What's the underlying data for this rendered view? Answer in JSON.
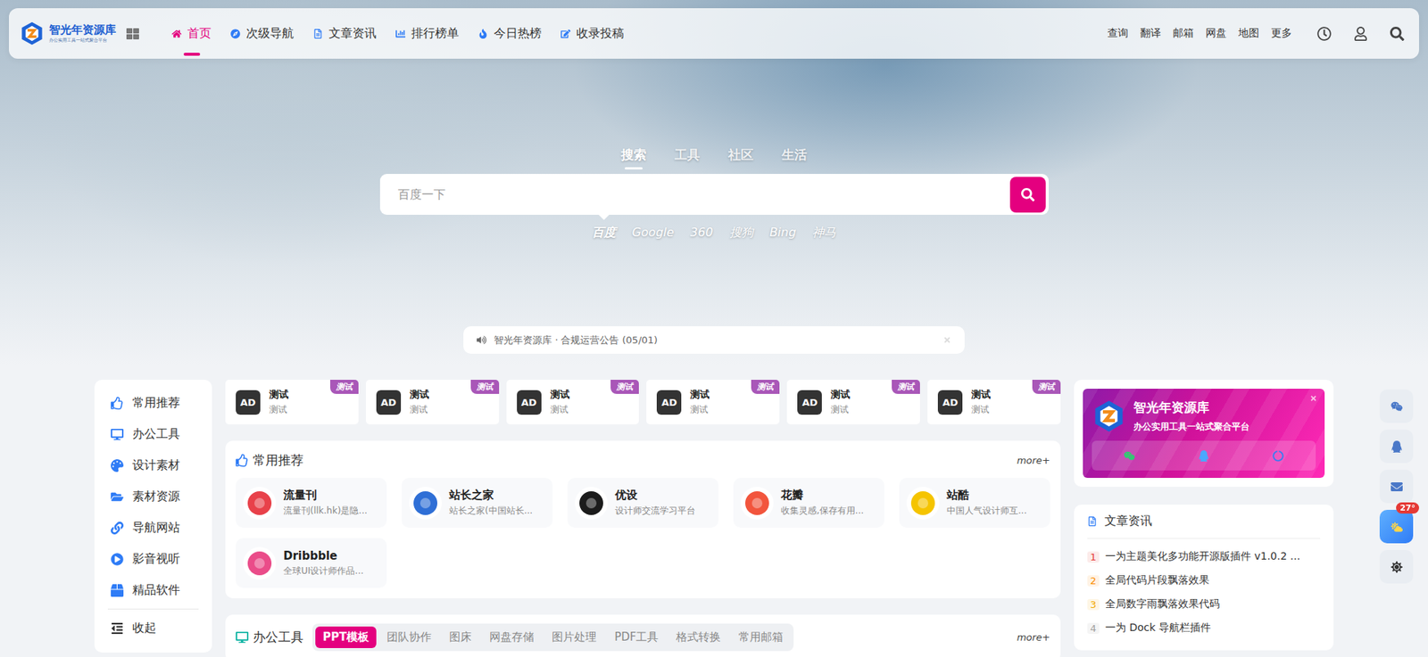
{
  "header": {
    "logo": {
      "title": "智光年资源库",
      "subtitle": "办公实用工具一站式聚合平台"
    },
    "nav": [
      {
        "label": "首页",
        "selected": true
      },
      {
        "label": "次级导航",
        "selected": false
      },
      {
        "label": "文章资讯",
        "selected": false
      },
      {
        "label": "排行榜单",
        "selected": false
      },
      {
        "label": "今日热榜",
        "selected": false
      },
      {
        "label": "收录投稿",
        "selected": false
      }
    ],
    "links": [
      "查询",
      "翻译",
      "邮箱",
      "网盘",
      "地图",
      "更多"
    ]
  },
  "search": {
    "tabs": [
      {
        "label": "搜索",
        "selected": true
      },
      {
        "label": "工具",
        "selected": false
      },
      {
        "label": "社区",
        "selected": false
      },
      {
        "label": "生活",
        "selected": false
      }
    ],
    "placeholder": "百度一下",
    "engines": [
      {
        "label": "百度",
        "selected": true
      },
      {
        "label": "Google",
        "selected": false
      },
      {
        "label": "360",
        "selected": false
      },
      {
        "label": "搜狗",
        "selected": false
      },
      {
        "label": "Bing",
        "selected": false
      },
      {
        "label": "神马",
        "selected": false
      }
    ]
  },
  "notice": {
    "text": "智光年资源库 · 合规运营公告 (05/01)"
  },
  "sidebar": {
    "items": [
      "常用推荐",
      "办公工具",
      "设计素材",
      "素材资源",
      "导航网站",
      "影音视听",
      "精品软件"
    ],
    "collapse": "收起"
  },
  "ads": [
    {
      "logo": "AD",
      "title": "测试",
      "desc": "测试",
      "badge": "测试"
    },
    {
      "logo": "AD",
      "title": "测试",
      "desc": "测试",
      "badge": "测试"
    },
    {
      "logo": "AD",
      "title": "测试",
      "desc": "测试",
      "badge": "测试"
    },
    {
      "logo": "AD",
      "title": "测试",
      "desc": "测试",
      "badge": "测试"
    },
    {
      "logo": "AD",
      "title": "测试",
      "desc": "测试",
      "badge": "测试"
    },
    {
      "logo": "AD",
      "title": "测试",
      "desc": "测试",
      "badge": "测试"
    }
  ],
  "recommend": {
    "title": "常用推荐",
    "more": "more+",
    "sites": [
      {
        "name": "流量刊",
        "desc": "流量刊(llk.hk)是隐...",
        "color": "#e8414a"
      },
      {
        "name": "站长之家",
        "desc": "站长之家(中国站长...",
        "color": "#2f6fd6"
      },
      {
        "name": "优设",
        "desc": "设计师交流学习平台",
        "color": "#1c1c1c"
      },
      {
        "name": "花瓣",
        "desc": "收集灵感,保存有用...",
        "color": "#f2553d"
      },
      {
        "name": "站酷",
        "desc": "中国人气设计师互...",
        "color": "#f5c400"
      },
      {
        "name": "Dribbble",
        "desc": "全球UI设计师作品...",
        "color": "#ea4c89"
      }
    ]
  },
  "office": {
    "title": "办公工具",
    "more": "more+",
    "tabs": [
      {
        "label": "PPT模板",
        "selected": true
      },
      {
        "label": "团队协作",
        "selected": false
      },
      {
        "label": "图床",
        "selected": false
      },
      {
        "label": "网盘存储",
        "selected": false
      },
      {
        "label": "图片处理",
        "selected": false
      },
      {
        "label": "PDF工具",
        "selected": false
      },
      {
        "label": "格式转换",
        "selected": false
      },
      {
        "label": "常用邮箱",
        "selected": false
      }
    ]
  },
  "promo": {
    "title": "智光年资源库",
    "subtitle": "办公实用工具一站式聚合平台"
  },
  "articles": {
    "title": "文章资讯",
    "items": [
      {
        "rank": "1",
        "title": "一为主题美化多功能开源版插件 v1.0.2 ...",
        "color": "#e53935"
      },
      {
        "rank": "2",
        "title": "全局代码片段飘落效果",
        "color": "#fb8c00"
      },
      {
        "rank": "3",
        "title": "全局数字雨飘落效果代码",
        "color": "#f2a900"
      },
      {
        "rank": "4",
        "title": "一为 Dock 导航栏插件",
        "color": "#9e9e9e"
      }
    ]
  },
  "floating": {
    "weather_badge": "27°"
  }
}
